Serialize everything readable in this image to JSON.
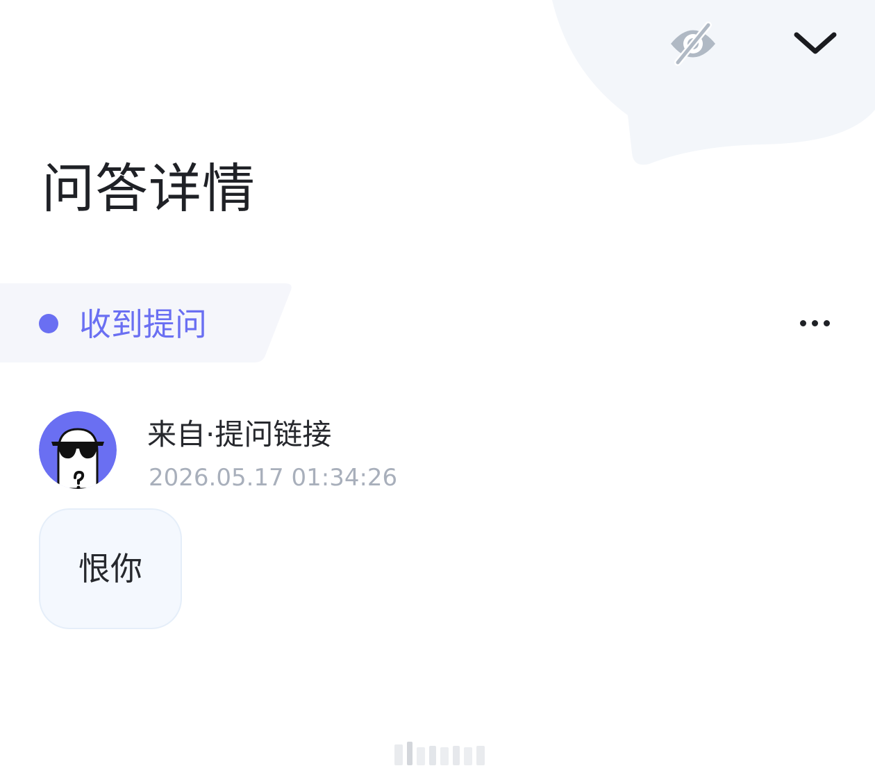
{
  "header": {
    "hide_icon": "eye-off-icon",
    "collapse_icon": "chevron-down-icon",
    "title": "问答详情"
  },
  "status": {
    "label": "收到提问",
    "color": "#6a6ff2",
    "more_icon": "more-horizontal-icon"
  },
  "question": {
    "avatar_icon": "sunglasses-ghost-avatar",
    "avatar_color": "#6a6ff2",
    "source": "来自·提问链接",
    "timestamp": "2026.05.17 01:34:26",
    "content": "恨你"
  }
}
